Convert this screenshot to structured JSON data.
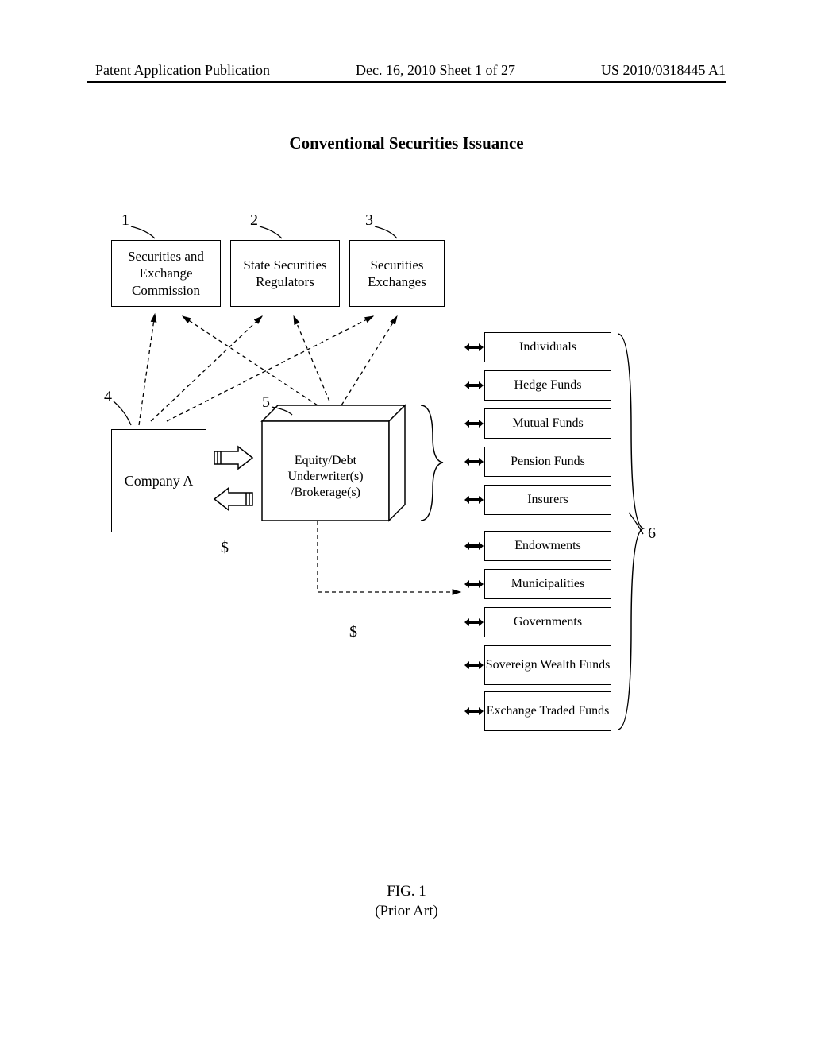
{
  "header": {
    "left": "Patent Application Publication",
    "center": "Dec. 16, 2010 Sheet 1 of 27",
    "right": "US 2010/0318445 A1"
  },
  "title": "Conventional Securities Issuance",
  "refs": {
    "r1": "1",
    "r2": "2",
    "r3": "3",
    "r4": "4",
    "r5": "5",
    "r6": "6"
  },
  "boxes": {
    "sec": "Securities and Exchange Commission",
    "state": "State Securities Regulators",
    "exchanges": "Securities Exchanges",
    "company": "Company A",
    "underwriter": "Equity/Debt Underwriter(s) /Brokerage(s)"
  },
  "investors": [
    "Individuals",
    "Hedge Funds",
    "Mutual Funds",
    "Pension Funds",
    "Insurers",
    "Endowments",
    "Municipalities",
    "Governments",
    "Sovereign Wealth Funds",
    "Exchange Traded Funds"
  ],
  "symbols": {
    "dollar1": "$",
    "dollar2": "$"
  },
  "figure": {
    "num": "FIG. 1",
    "note": "(Prior Art)"
  }
}
